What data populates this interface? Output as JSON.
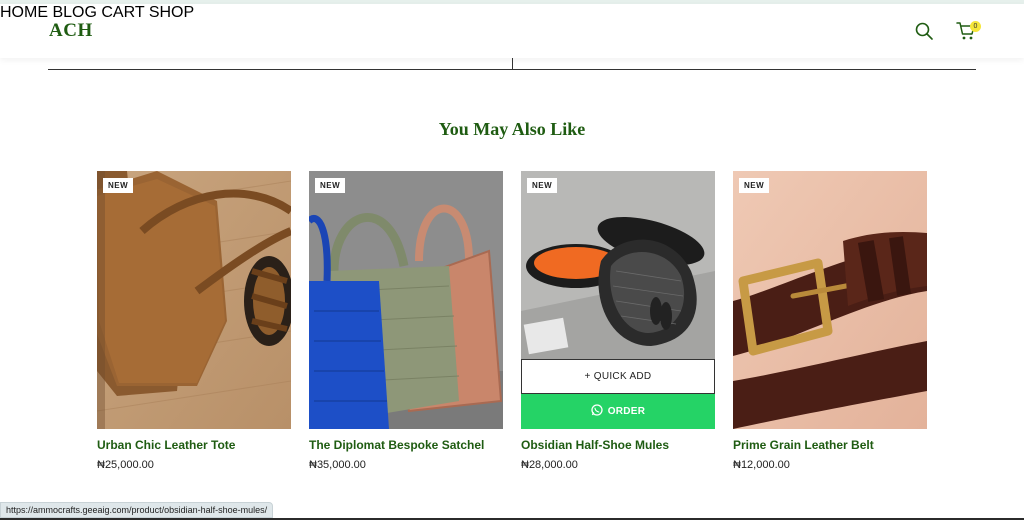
{
  "header": {
    "logo": "ACH",
    "nav": [
      {
        "label": "HOME"
      },
      {
        "label": "BLOG"
      },
      {
        "label": "CART"
      },
      {
        "label": "SHOP"
      }
    ],
    "cart_count": "0",
    "icons": [
      "search-icon",
      "cart-icon"
    ]
  },
  "section": {
    "title": "You May Also Like"
  },
  "products": [
    {
      "badge": "NEW",
      "name": "Urban Chic Leather Tote",
      "price": "₦25,000.00",
      "image": "tote-bag"
    },
    {
      "badge": "NEW",
      "name": "The Diplomat Bespoke Satchel",
      "price": "₦35,000.00",
      "image": "satchel-bags"
    },
    {
      "badge": "NEW",
      "name": "Obsidian Half-Shoe Mules",
      "price": "₦28,000.00",
      "image": "mule-shoes",
      "quick_add": "+ QUICK ADD",
      "order": "ORDER"
    },
    {
      "badge": "NEW",
      "name": "Prime Grain Leather Belt",
      "price": "₦12,000.00",
      "image": "leather-belt"
    }
  ],
  "status_bar": {
    "url": "https://ammocrafts.geeaig.com/product/obsidian-half-shoe-mules/"
  },
  "colors": {
    "brand": "#1f5c12",
    "order_button": "#25d366",
    "cart_badge": "#f5e63a"
  }
}
